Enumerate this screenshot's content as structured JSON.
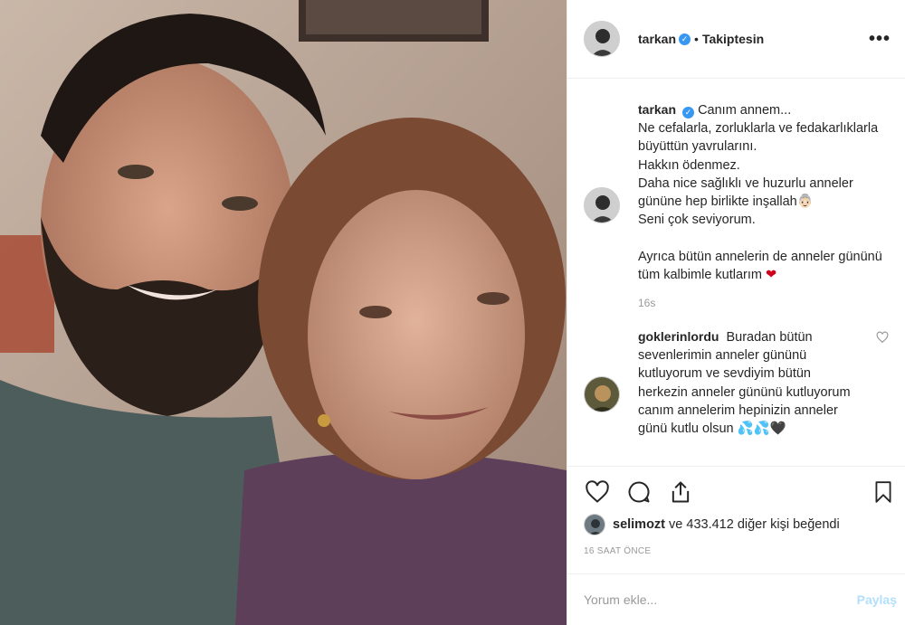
{
  "post": {
    "author": "tarkan",
    "verified_mark": "✓",
    "separator": "•",
    "follow_status": "Takiptesin",
    "more_label": "•••"
  },
  "caption": {
    "author": "tarkan",
    "text": "Canım annem...\nNe cefalarla, zorluklarla ve fedakarlıklarla büyüttün yavrularını.\nHakkın ödenmez.\nDaha nice sağlıklı ve huzurlu anneler gününe hep birlikte inşallah👵🏻\nSeni çok seviyorum.\n\nAyrıca bütün annelerin de anneler gününü tüm kalbimle kutlarım",
    "heart": "❤",
    "time": "16s"
  },
  "comment": {
    "author": "goklerinlordu",
    "text": "Buradan bütün sevenlerimin anneler gününü kutluyorum ve sevdiyim bütün herkezin anneler gününü kutluyorum canım annelerim hepinizin anneler günü kutlu olsun 💦💦🖤"
  },
  "likes": {
    "first_user": "selimozt",
    "rest": " ve 433.412 diğer kişi beğendi"
  },
  "timestamp": "16 SAAT ÖNCE",
  "add_comment": {
    "placeholder": "Yorum ekle...",
    "share_label": "Paylaş"
  },
  "icons": [
    "heart-icon",
    "comment-icon",
    "share-icon",
    "bookmark-icon",
    "verified-icon",
    "more-icon"
  ],
  "colors": {
    "link_blue": "#3897f0",
    "disabled_blue": "#b2dffc",
    "heart_red": "#d0021b",
    "muted": "#999999"
  }
}
